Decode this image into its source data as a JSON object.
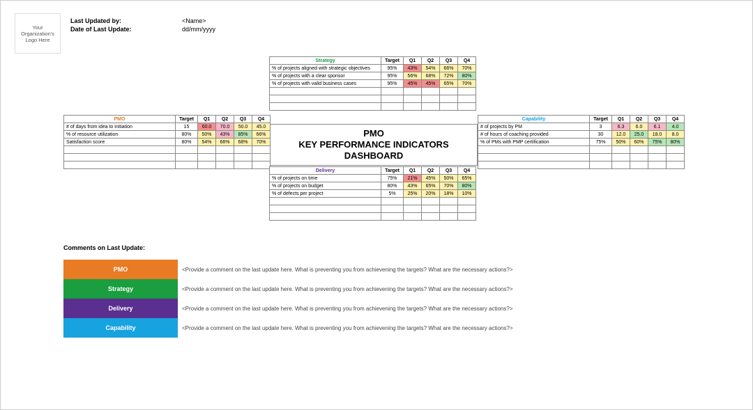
{
  "header": {
    "logo_text": "Your Organization's Logo Here",
    "updated_by_label": "Last Updated by:",
    "updated_by_value": "<Name>",
    "update_date_label": "Date of Last Update:",
    "update_date_value": "dd/mm/yyyy"
  },
  "center_title_1": "PMO",
  "center_title_2": "KEY PERFORMANCE INDICATORS",
  "center_title_3": "DASHBOARD",
  "cols": {
    "target": "Target",
    "q1": "Q1",
    "q2": "Q2",
    "q3": "Q3",
    "q4": "Q4"
  },
  "pmo": {
    "title": "PMO",
    "rows": [
      {
        "m": "# of days from idea to initiation",
        "t": "15",
        "q1": "60.0",
        "q2": "70.0",
        "q3": "50.0",
        "q4": "45.0",
        "c1": "val-red",
        "c2": "val-pnk",
        "c3": "val-yel",
        "c4": "val-yel"
      },
      {
        "m": "% of resource utilization",
        "t": "80%",
        "q1": "50%",
        "q2": "43%",
        "q3": "85%",
        "q4": "66%",
        "c1": "val-yel",
        "c2": "val-pnk",
        "c3": "val-grn",
        "c4": "val-yel"
      },
      {
        "m": "Satisfaction score",
        "t": "80%",
        "q1": "54%",
        "q2": "66%",
        "q3": "68%",
        "q4": "70%",
        "c1": "val-yel",
        "c2": "val-yel",
        "c3": "val-yel",
        "c4": "val-yel"
      }
    ]
  },
  "strategy": {
    "title": "Strategy",
    "rows": [
      {
        "m": "% of projects aligned with strategic objectives",
        "t": "95%",
        "q1": "43%",
        "q2": "54%",
        "q3": "66%",
        "q4": "70%",
        "c1": "val-red",
        "c2": "val-yel",
        "c3": "val-yel",
        "c4": "val-yel"
      },
      {
        "m": "% of projects with a clear sponsor",
        "t": "95%",
        "q1": "56%",
        "q2": "68%",
        "q3": "72%",
        "q4": "80%",
        "c1": "val-yel",
        "c2": "val-yel",
        "c3": "val-yel",
        "c4": "val-grn"
      },
      {
        "m": "% of projects with valid business cases",
        "t": "95%",
        "q1": "45%",
        "q2": "45%",
        "q3": "65%",
        "q4": "70%",
        "c1": "val-red",
        "c2": "val-red",
        "c3": "val-yel",
        "c4": "val-yel"
      }
    ]
  },
  "delivery": {
    "title": "Delivery",
    "rows": [
      {
        "m": "% of projects on time",
        "t": "75%",
        "q1": "21%",
        "q2": "45%",
        "q3": "50%",
        "q4": "65%",
        "c1": "val-red",
        "c2": "val-yel",
        "c3": "val-yel",
        "c4": "val-yel"
      },
      {
        "m": "% of projects on budget",
        "t": "80%",
        "q1": "43%",
        "q2": "65%",
        "q3": "70%",
        "q4": "80%",
        "c1": "val-yel",
        "c2": "val-yel",
        "c3": "val-yel",
        "c4": "val-grn"
      },
      {
        "m": "% of defects per project",
        "t": "5%",
        "q1": "25%",
        "q2": "20%",
        "q3": "18%",
        "q4": "10%",
        "c1": "val-yel",
        "c2": "val-yel",
        "c3": "val-yel",
        "c4": "val-yel"
      }
    ]
  },
  "capability": {
    "title": "Capability",
    "rows": [
      {
        "m": "# of projects by PM",
        "t": "3",
        "q1": "6.3",
        "q2": "6.0",
        "q3": "6.1",
        "q4": "4.0",
        "c1": "val-pnk",
        "c2": "val-yel",
        "c3": "val-pnk",
        "c4": "val-grn"
      },
      {
        "m": "# of hours of coaching provided",
        "t": "30",
        "q1": "12.0",
        "q2": "25.0",
        "q3": "18.0",
        "q4": "8.0",
        "c1": "val-yel",
        "c2": "val-grn",
        "c3": "val-yel",
        "c4": "val-yel"
      },
      {
        "m": "% of PMs with PMP certification",
        "t": "75%",
        "q1": "50%",
        "q2": "60%",
        "q3": "75%",
        "q4": "80%",
        "c1": "val-yel",
        "c2": "val-yel",
        "c3": "val-grn",
        "c4": "val-grn"
      }
    ]
  },
  "comments": {
    "title": "Comments on Last Update:",
    "placeholder": "<Provide a comment on the last update here. What is preventing you from achievening the targets? What are the necessary actions?>",
    "labels": {
      "pmo": "PMO",
      "strategy": "Strategy",
      "delivery": "Delivery",
      "capability": "Capability"
    }
  }
}
